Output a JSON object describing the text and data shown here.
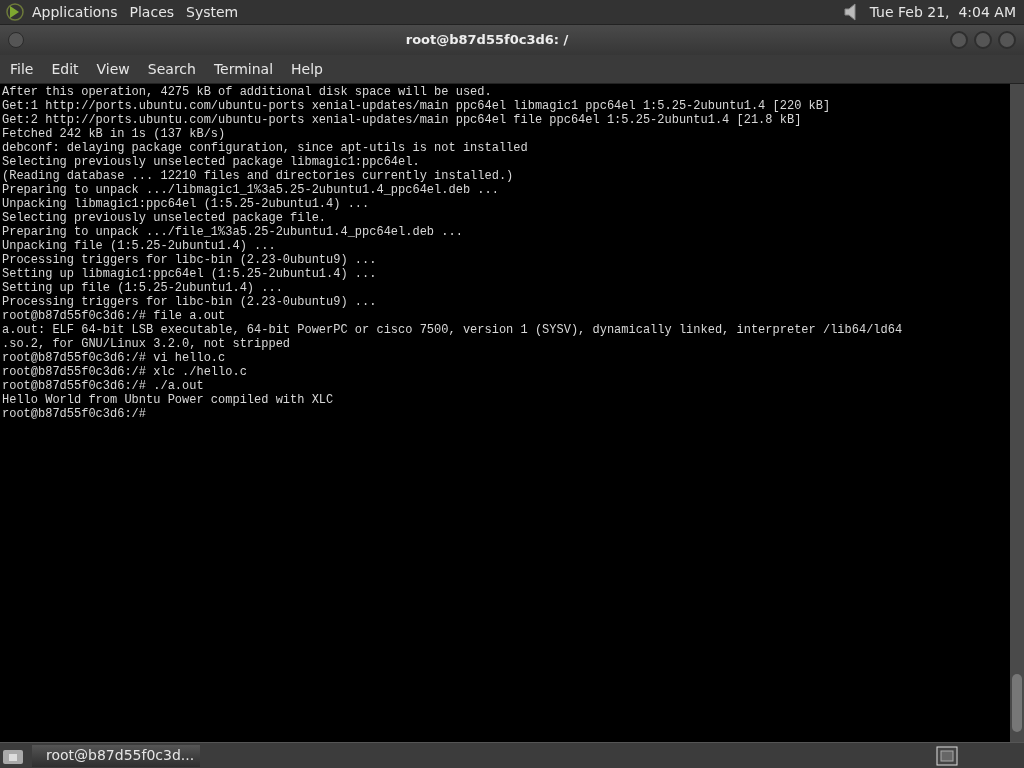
{
  "top_panel": {
    "menus": [
      "Applications",
      "Places",
      "System"
    ],
    "clock": "Tue Feb 21,  4:04 AM"
  },
  "window": {
    "title": "root@b87d55f0c3d6: /"
  },
  "menu_bar": [
    "File",
    "Edit",
    "View",
    "Search",
    "Terminal",
    "Help"
  ],
  "terminal": {
    "lines": [
      "After this operation, 4275 kB of additional disk space will be used.",
      "Get:1 http://ports.ubuntu.com/ubuntu-ports xenial-updates/main ppc64el libmagic1 ppc64el 1:5.25-2ubuntu1.4 [220 kB]",
      "Get:2 http://ports.ubuntu.com/ubuntu-ports xenial-updates/main ppc64el file ppc64el 1:5.25-2ubuntu1.4 [21.8 kB]",
      "Fetched 242 kB in 1s (137 kB/s)",
      "debconf: delaying package configuration, since apt-utils is not installed",
      "Selecting previously unselected package libmagic1:ppc64el.",
      "(Reading database ... 12210 files and directories currently installed.)",
      "Preparing to unpack .../libmagic1_1%3a5.25-2ubuntu1.4_ppc64el.deb ...",
      "Unpacking libmagic1:ppc64el (1:5.25-2ubuntu1.4) ...",
      "Selecting previously unselected package file.",
      "Preparing to unpack .../file_1%3a5.25-2ubuntu1.4_ppc64el.deb ...",
      "Unpacking file (1:5.25-2ubuntu1.4) ...",
      "Processing triggers for libc-bin (2.23-0ubuntu9) ...",
      "Setting up libmagic1:ppc64el (1:5.25-2ubuntu1.4) ...",
      "Setting up file (1:5.25-2ubuntu1.4) ...",
      "Processing triggers for libc-bin (2.23-0ubuntu9) ...",
      "root@b87d55f0c3d6:/# file a.out",
      "a.out: ELF 64-bit LSB executable, 64-bit PowerPC or cisco 7500, version 1 (SYSV), dynamically linked, interpreter /lib64/ld64",
      ".so.2, for GNU/Linux 3.2.0, not stripped",
      "root@b87d55f0c3d6:/# vi hello.c",
      "root@b87d55f0c3d6:/# xlc ./hello.c",
      "root@b87d55f0c3d6:/# ./a.out",
      "Hello World from Ubntu Power compiled with XLC",
      "root@b87d55f0c3d6:/#"
    ]
  },
  "taskbar": {
    "tasks": [
      {
        "label": "root@b87d55f0c3d...",
        "selected": true
      }
    ]
  }
}
